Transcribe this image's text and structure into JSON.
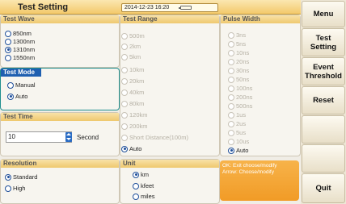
{
  "header": {
    "title": "Test Setting",
    "datetime": "2014-12-23 16:20"
  },
  "test_wave": {
    "title": "Test Wave",
    "options": [
      "850nm",
      "1300nm",
      "1310nm",
      "1550nm"
    ],
    "selected": "1310nm"
  },
  "test_mode": {
    "title": "Test Mode",
    "options": [
      "Manual",
      "Auto"
    ],
    "selected": "Auto"
  },
  "test_time": {
    "title": "Test Time",
    "value": "10",
    "unit": "Second"
  },
  "test_range": {
    "title": "Test Range",
    "options": [
      "500m",
      "2km",
      "5km",
      "10km",
      "20km",
      "40km",
      "80km",
      "120km",
      "200km",
      "Short Distance(100m)",
      "Auto"
    ],
    "selected": "Auto"
  },
  "pulse_width": {
    "title": "Pulse Width",
    "options": [
      "3ns",
      "5ns",
      "10ns",
      "20ns",
      "30ns",
      "50ns",
      "100ns",
      "200ns",
      "500ns",
      "1us",
      "2us",
      "5us",
      "10us",
      "Auto"
    ],
    "selected": "Auto"
  },
  "resolution": {
    "title": "Resolution",
    "options": [
      "Standard",
      "High"
    ],
    "selected": "Standard"
  },
  "unit": {
    "title": "Unit",
    "options": [
      "km",
      "kfeet",
      "miles"
    ],
    "selected": "km"
  },
  "hint": {
    "line1": "OK: Exit choose/modify",
    "line2": "Arrow: Choose/modify"
  },
  "menu": {
    "items": [
      "Menu",
      "Test Setting",
      "Event Threshold",
      "Reset",
      "",
      "",
      "",
      "Quit"
    ]
  },
  "colors": {
    "accent": "#1f5fb0",
    "header": "#f3c96b",
    "hint": "#f19b26"
  }
}
